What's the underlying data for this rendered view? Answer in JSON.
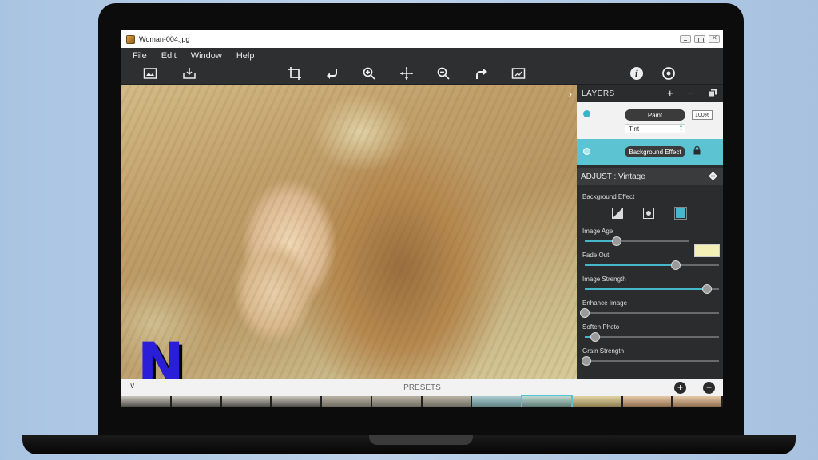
{
  "window": {
    "title": "Woman-004.jpg"
  },
  "menu": [
    "File",
    "Edit",
    "Window",
    "Help"
  ],
  "toolbar": {
    "icons": [
      "image-icon",
      "export-icon",
      "crop-icon",
      "rotate-left-icon",
      "zoom-in-icon",
      "pan-icon",
      "zoom-out-icon",
      "rotate-right-icon",
      "fit-screen-icon",
      "info-icon",
      "settings-icon"
    ]
  },
  "layers": {
    "heading": "LAYERS",
    "add": "+",
    "remove": "−",
    "items": [
      {
        "name": "Paint",
        "opacity": "100%",
        "blend": "Tint"
      },
      {
        "name": "Background Effect"
      }
    ]
  },
  "adjust": {
    "heading": "ADJUST : Vintage",
    "effect_label": "Background Effect",
    "swatch_color": "#f3efb6",
    "accent": "#47b7cb",
    "sliders": [
      {
        "label": "Image Age",
        "value": 0.31
      },
      {
        "label": "Fade Out",
        "value": 0.68
      },
      {
        "label": "Image Strength",
        "value": 0.91
      },
      {
        "label": "Enhance Image",
        "value": 0.0
      },
      {
        "label": "Soften Photo",
        "value": 0.08
      },
      {
        "label": "Grain Strength",
        "value": 0.01
      }
    ]
  },
  "presets": {
    "label": "PRESETS",
    "add": "+",
    "remove": "−"
  },
  "overlay_logo": "N"
}
